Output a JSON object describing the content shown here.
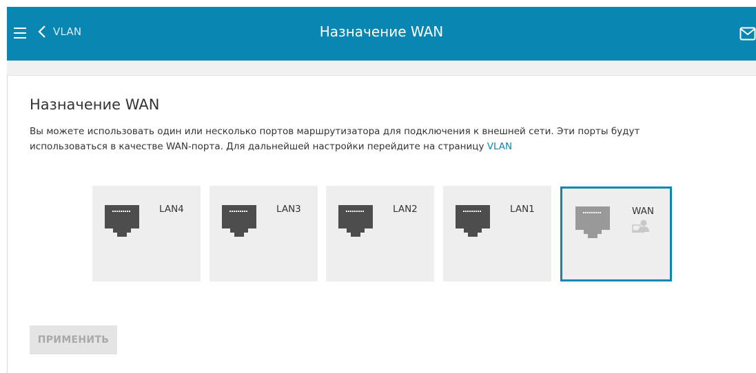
{
  "header": {
    "back_label": "VLAN",
    "title": "Назначение WAN",
    "icons": {
      "menu": "hamburger-menu-icon",
      "back": "chevron-left-icon",
      "notifications": "mail-icon"
    }
  },
  "section": {
    "title": "Назначение WAN",
    "description_before_link": "Вы можете использовать один или несколько портов маршрутизатора для подключения к внешней сети. Эти порты будут использоваться в качестве WAN-порта. Для дальнейшей настройки перейдите на страницу ",
    "description_link": "VLAN"
  },
  "ports": [
    {
      "label": "LAN4",
      "selected": false
    },
    {
      "label": "LAN3",
      "selected": false
    },
    {
      "label": "LAN2",
      "selected": false
    },
    {
      "label": "LAN1",
      "selected": false
    },
    {
      "label": "WAN",
      "selected": true
    }
  ],
  "apply_button": {
    "label": "ПРИМЕНИТЬ",
    "enabled": false
  },
  "colors": {
    "accent": "#0a86b2",
    "port_bg": "#eeeeee",
    "jack_active": "#4d4d4d",
    "jack_wan": "#999999"
  }
}
